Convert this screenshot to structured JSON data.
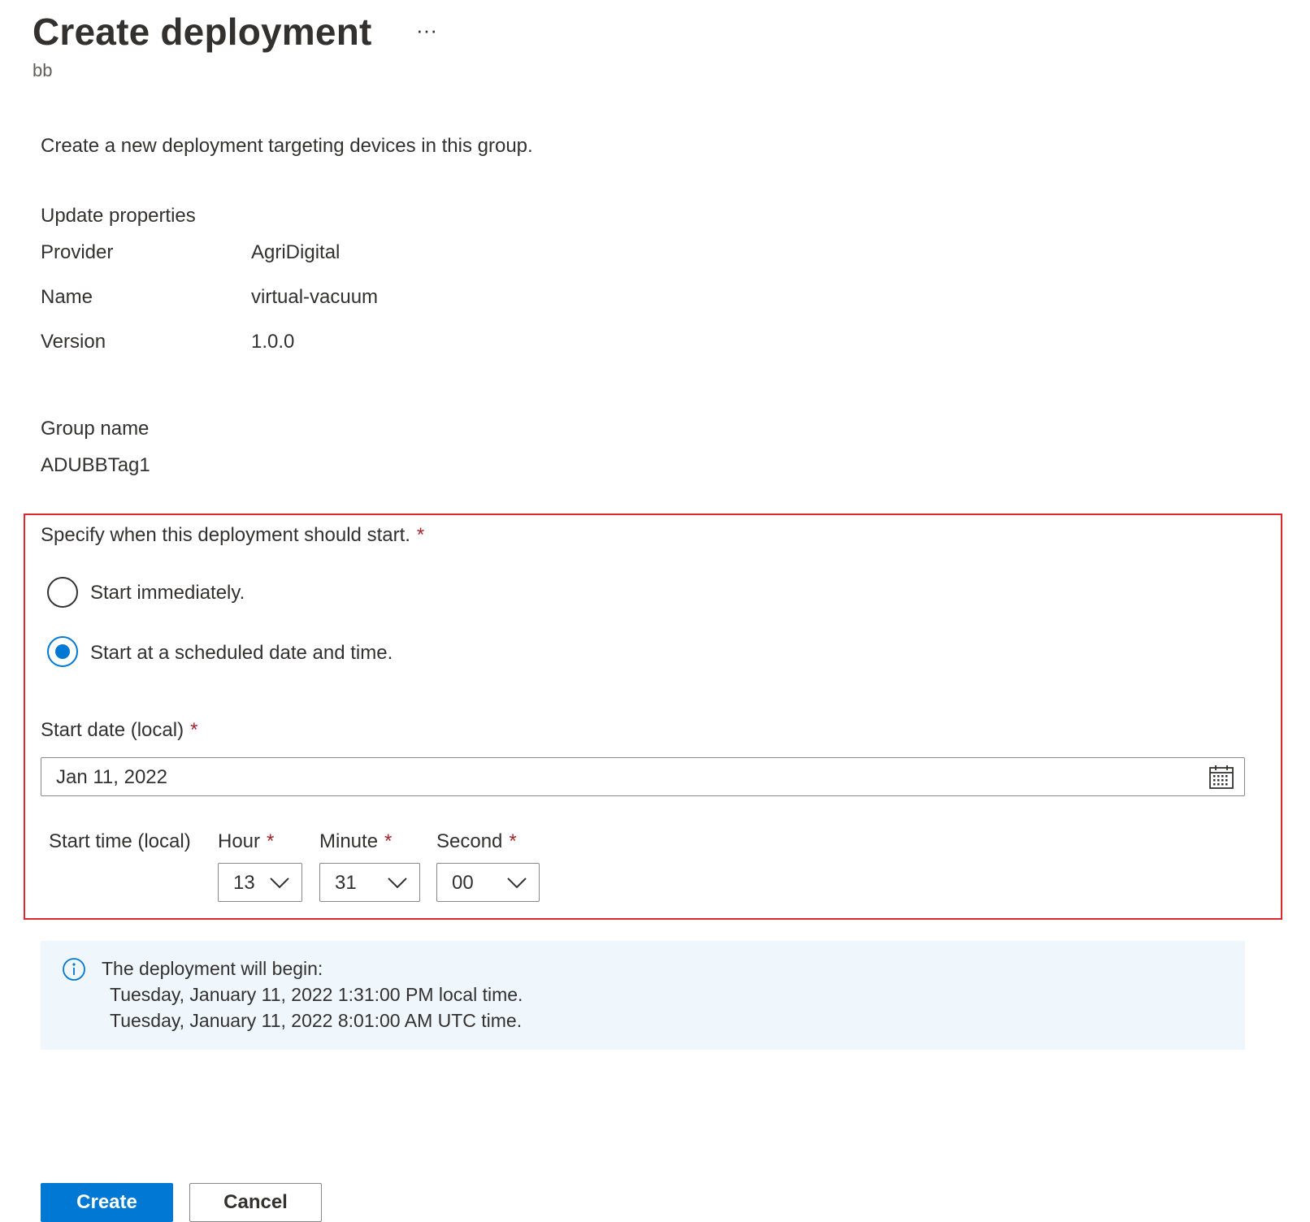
{
  "header": {
    "title": "Create deployment",
    "more_label": "···",
    "subtitle": "bb"
  },
  "description": "Create a new deployment targeting devices in this group.",
  "update_properties": {
    "heading": "Update properties",
    "rows": [
      {
        "label": "Provider",
        "value": "AgriDigital"
      },
      {
        "label": "Name",
        "value": "virtual-vacuum"
      },
      {
        "label": "Version",
        "value": "1.0.0"
      }
    ]
  },
  "group": {
    "label": "Group name",
    "value": "ADUBBTag1"
  },
  "schedule": {
    "question": "Specify when this deployment should start.",
    "required_mark": "*",
    "options": [
      {
        "label": "Start immediately.",
        "selected": false
      },
      {
        "label": "Start at a scheduled date and time.",
        "selected": true
      }
    ],
    "start_date": {
      "label": "Start date (local)",
      "value": "Jan 11, 2022",
      "icon": "calendar-icon"
    },
    "start_time": {
      "label": "Start time (local)",
      "hour": {
        "label": "Hour",
        "value": "13"
      },
      "minute": {
        "label": "Minute",
        "value": "31"
      },
      "second": {
        "label": "Second",
        "value": "00"
      }
    }
  },
  "info": {
    "icon": "info-icon",
    "heading": "The deployment will begin:",
    "local_time": "Tuesday, January 11, 2022 1:31:00 PM local time.",
    "utc_time": "Tuesday, January 11, 2022 8:01:00 AM UTC time."
  },
  "actions": {
    "create_label": "Create",
    "cancel_label": "Cancel"
  },
  "colors": {
    "accent": "#0078d4",
    "highlight_border": "#e0262a",
    "required": "#a4262c",
    "info_background": "#eff6fc"
  }
}
